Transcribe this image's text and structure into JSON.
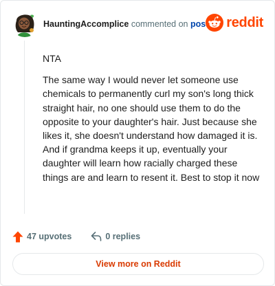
{
  "header": {
    "username": "HauntingAccomplice",
    "verb": "commented on",
    "post_link": "post",
    "logo_text": "reddit"
  },
  "comment": {
    "paragraphs": [
      "NTA",
      "The same way I would never let someone use chemicals to permanently curl my son's long thick straight hair, no one should use them to do the opposite to your daughter's hair. Just because she likes it, she doesn't understand how damaged it is. And if grandma keeps it up, eventually your daughter will learn how racially charged these things are and learn to resent it. Best to stop it now"
    ]
  },
  "actions": {
    "upvotes": "47 upvotes",
    "replies": "0 replies"
  },
  "footer": {
    "view_more": "View more on Reddit"
  },
  "colors": {
    "brand": "#ff4500",
    "link": "#0045ac",
    "muted": "#576f76",
    "view_more": "#d93a00"
  }
}
